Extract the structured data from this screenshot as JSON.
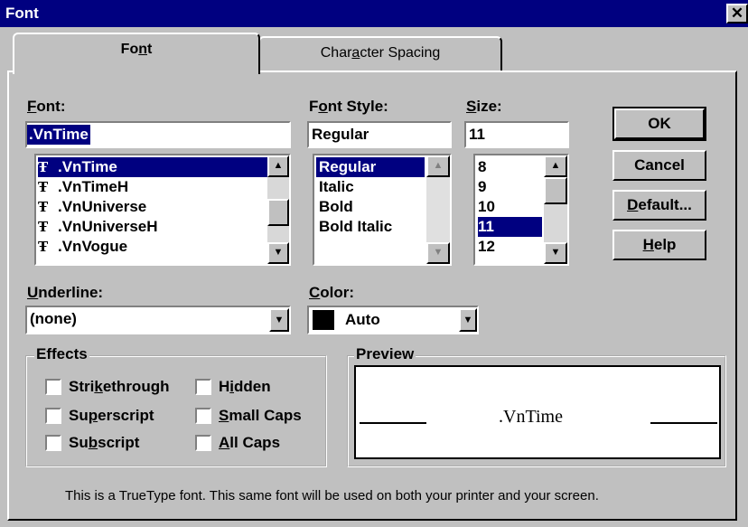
{
  "window": {
    "title": "Font",
    "close": "✕"
  },
  "tabs": [
    {
      "label": "Font",
      "underline_index": 2
    },
    {
      "label": "Character Spacing",
      "underline_index": 4
    }
  ],
  "font": {
    "label": "Font:",
    "value": ".VnTime",
    "items": [
      ".VnTime",
      ".VnTimeH",
      ".VnUniverse",
      ".VnUniverseH",
      ".VnVogue"
    ],
    "selected": ".VnTime",
    "icon": "truetype-icon"
  },
  "font_style": {
    "label": "Font Style:",
    "value": "Regular",
    "items": [
      "Regular",
      "Italic",
      "Bold",
      "Bold Italic"
    ],
    "selected": "Regular"
  },
  "size": {
    "label": "Size:",
    "value": "11",
    "items": [
      "8",
      "9",
      "10",
      "11",
      "12"
    ],
    "selected": "11"
  },
  "buttons": {
    "ok": "OK",
    "cancel": "Cancel",
    "default": "Default...",
    "help": "Help"
  },
  "underline": {
    "label": "Underline:",
    "value": "(none)"
  },
  "color": {
    "label": "Color:",
    "value": "Auto",
    "swatch": "#000000"
  },
  "effects": {
    "title": "Effects",
    "items": [
      {
        "label": "Strikethrough",
        "checked": false
      },
      {
        "label": "Hidden",
        "checked": false
      },
      {
        "label": "Superscript",
        "checked": false
      },
      {
        "label": "Small Caps",
        "checked": false
      },
      {
        "label": "Subscript",
        "checked": false
      },
      {
        "label": "All Caps",
        "checked": false
      }
    ]
  },
  "preview": {
    "title": "Preview",
    "text": ".VnTime"
  },
  "footer_note": "This is a TrueType font. This same font will be used on both your printer and your screen.",
  "colors": {
    "titlebar": "#000080",
    "selection": "#000080",
    "face": "#c0c0c0"
  }
}
